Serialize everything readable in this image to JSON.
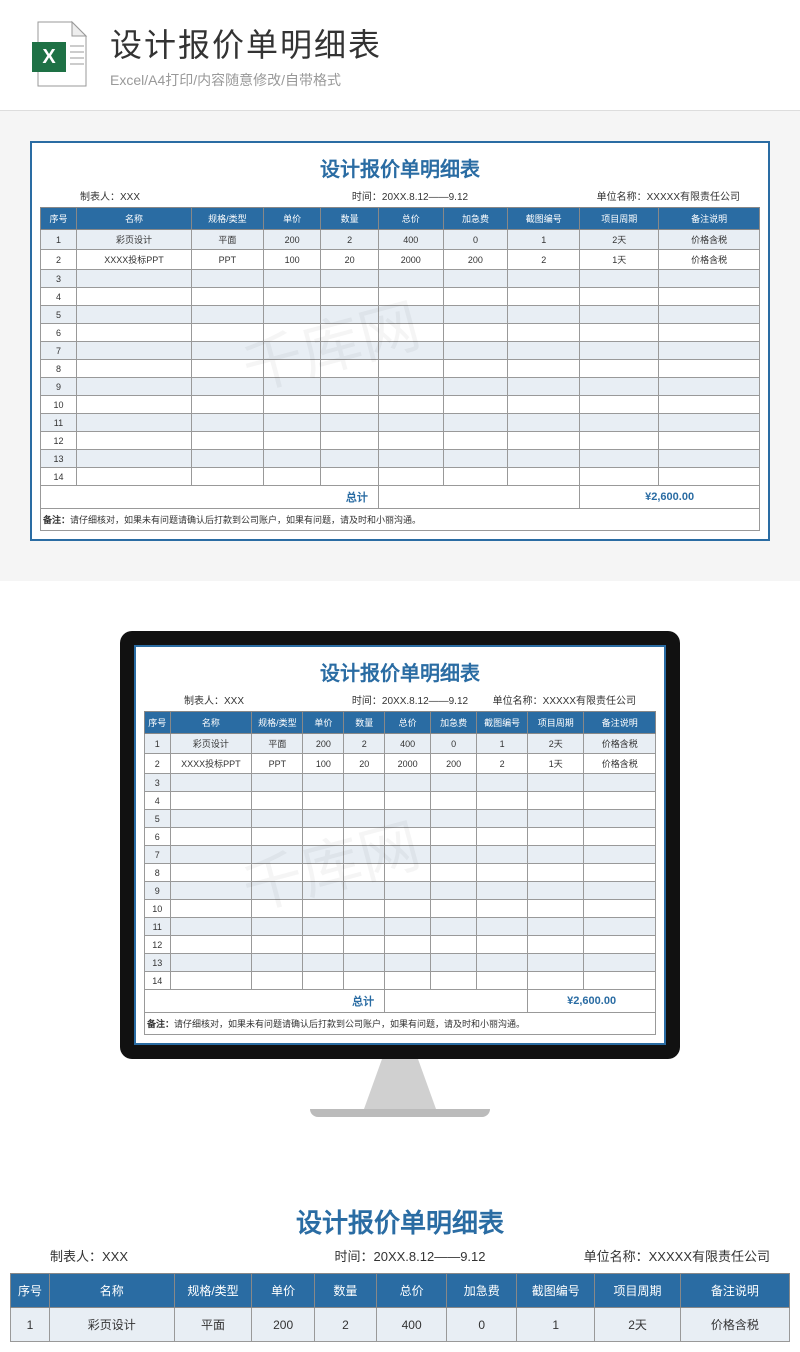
{
  "header": {
    "title": "设计报价单明细表",
    "subtitle": "Excel/A4打印/内容随意修改/自带格式"
  },
  "sheet": {
    "title": "设计报价单明细表",
    "meta": {
      "author_label": "制表人：",
      "author": "XXX",
      "time_label": "时间：",
      "time": "20XX.8.12——9.12",
      "company_label": "单位名称：",
      "company": "XXXXX有限责任公司"
    },
    "columns": [
      "序号",
      "名称",
      "规格/类型",
      "单价",
      "数量",
      "总价",
      "加急费",
      "截图编号",
      "项目周期",
      "备注说明"
    ],
    "rows": [
      {
        "seq": "1",
        "name": "彩页设计",
        "spec": "平面",
        "price": "200",
        "qty": "2",
        "total": "400",
        "rush": "0",
        "imgno": "1",
        "period": "2天",
        "remark": "价格含税"
      },
      {
        "seq": "2",
        "name": "XXXX投标PPT",
        "spec": "PPT",
        "price": "100",
        "qty": "20",
        "total": "2000",
        "rush": "200",
        "imgno": "2",
        "period": "1天",
        "remark": "价格含税"
      },
      {
        "seq": "3"
      },
      {
        "seq": "4"
      },
      {
        "seq": "5"
      },
      {
        "seq": "6"
      },
      {
        "seq": "7"
      },
      {
        "seq": "8"
      },
      {
        "seq": "9"
      },
      {
        "seq": "10"
      },
      {
        "seq": "11"
      },
      {
        "seq": "12"
      },
      {
        "seq": "13"
      },
      {
        "seq": "14"
      }
    ],
    "total_label": "总计",
    "total_value": "¥2,600.00",
    "note_label": "备注：",
    "note": "请仔细核对，如果未有问题请确认后打款到公司账户，如果有问题，请及时和小丽沟通。"
  },
  "watermark": "千库网",
  "chart_data": {
    "type": "table",
    "title": "设计报价单明细表",
    "columns": [
      "序号",
      "名称",
      "规格/类型",
      "单价",
      "数量",
      "总价",
      "加急费",
      "截图编号",
      "项目周期",
      "备注说明"
    ],
    "rows": [
      [
        "1",
        "彩页设计",
        "平面",
        200,
        2,
        400,
        0,
        "1",
        "2天",
        "价格含税"
      ],
      [
        "2",
        "XXXX投标PPT",
        "PPT",
        100,
        20,
        2000,
        200,
        "2",
        "1天",
        "价格含税"
      ]
    ],
    "total": 2600.0,
    "currency": "CNY"
  }
}
